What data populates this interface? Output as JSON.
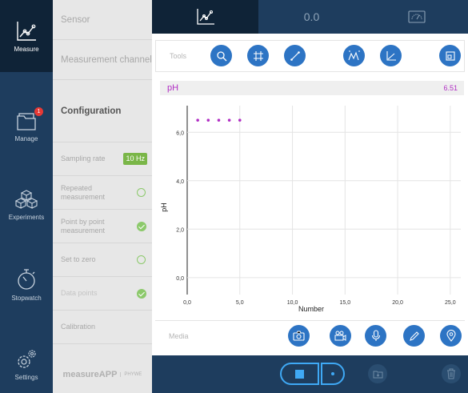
{
  "nav": {
    "items": [
      {
        "label": "Measure",
        "icon": "measure-chart-icon",
        "active": true
      },
      {
        "label": "Manage",
        "icon": "folder-icon",
        "badge": "1"
      },
      {
        "label": "Experiments",
        "icon": "cubes-icon"
      },
      {
        "label": "Stopwatch",
        "icon": "stopwatch-icon"
      },
      {
        "label": "Settings",
        "icon": "gear-icon"
      }
    ]
  },
  "panel": {
    "sensor": "Sensor",
    "measurement_channel": "Measurement channel",
    "configuration": "Configuration",
    "sampling_rate": "Sampling rate",
    "sampling_rate_value": "10 Hz",
    "repeated_measurement": "Repeated measurement",
    "point_by_point": "Point by point measurement",
    "set_to_zero": "Set to zero",
    "data_points": "Data points",
    "calibration": "Calibration",
    "brand": "measureAPP",
    "brand_sub": "PHYWE"
  },
  "topbar": {
    "tabs": [
      {
        "icon": "graph-icon",
        "active": true
      },
      {
        "label": "0.0"
      },
      {
        "icon": "gauge-icon"
      }
    ]
  },
  "tools": {
    "label": "Tools",
    "buttons": [
      "zoom-icon",
      "crosshair-icon",
      "line-icon",
      "peaks-icon",
      "slope-icon",
      "fit-screen-icon"
    ]
  },
  "valuebar": {
    "name": "pH",
    "value": "6.51",
    "color": "#b12ec4"
  },
  "chart_data": {
    "type": "scatter",
    "xlabel": "Number",
    "ylabel": "pH",
    "x_ticks": [
      "0,0",
      "5,0",
      "10,0",
      "15,0",
      "20,0",
      "25,0"
    ],
    "y_ticks": [
      "0,0",
      "2,0",
      "4,0",
      "6,0"
    ],
    "xlim": [
      0,
      26
    ],
    "ylim": [
      -0.7,
      7.1
    ],
    "series": [
      {
        "x": [
          1,
          2,
          3,
          4,
          5
        ],
        "y": [
          6.5,
          6.5,
          6.5,
          6.5,
          6.5
        ],
        "color": "#b12ec4"
      }
    ],
    "grid": true
  },
  "media": {
    "label": "Media",
    "buttons": [
      "camera-icon",
      "video-icon",
      "microphone-icon",
      "pencil-icon",
      "location-pin-icon"
    ]
  },
  "bottom": {
    "buttons": [
      "stop-icon",
      "point-icon",
      "save-icon",
      "trash-icon"
    ],
    "accent": "#3fa9f5"
  }
}
